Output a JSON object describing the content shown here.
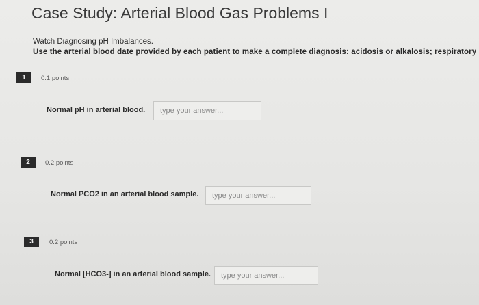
{
  "page": {
    "title": "Case Study: Arterial Blood Gas Problems I",
    "instruction_1": "Watch Diagnosing pH Imbalances.",
    "instruction_2": "Use the arterial blood date provided by each patient to make a complete diagnosis: acidosis or alkalosis; respiratory"
  },
  "questions": [
    {
      "number": "1",
      "points": "0.1 points",
      "prompt": "Normal pH in arterial blood.",
      "answer_placeholder": "type your answer..."
    },
    {
      "number": "2",
      "points": "0.2 points",
      "prompt": "Normal PCO2 in an arterial blood sample.",
      "answer_placeholder": "type your answer..."
    },
    {
      "number": "3",
      "points": "0.2 points",
      "prompt": "Normal [HCO3-] in an arterial blood sample.",
      "answer_placeholder": "type your answer..."
    }
  ],
  "colors": {
    "background": "#e9e9e7",
    "badge": "#2b2b2b",
    "text": "#2b2b2b"
  }
}
